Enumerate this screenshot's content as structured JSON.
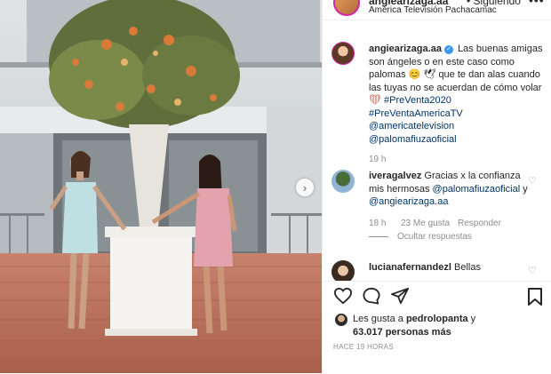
{
  "colors": {
    "accent": "#3897f0",
    "link": "#003569",
    "text": "#262626",
    "muted": "#8e8e8e",
    "heart_emoji": "#c0392b"
  },
  "header": {
    "username": "angiearizaga.aa",
    "follow_label": "• Siguiendo",
    "location": "América Televisión Pachacamac",
    "more_label": "•••"
  },
  "photo": {
    "next_label": "›"
  },
  "caption": {
    "username": "angiearizaga.aa",
    "text_1": "Las buenas amigas son ángeles o en este caso como palomas",
    "emoji_1": "😊",
    "emoji_2": "🕊",
    "text_2": "que te dan alas cuando las tuyas no se acuerdan de cómo volar",
    "emoji_3": "❤",
    "hashtag_1": "#PreVenta2020",
    "hashtag_2": "#PreVentaAmericaTV",
    "mention_1": "@americatelevision",
    "mention_2": "@palomafiuzaoficial",
    "time": "19 h"
  },
  "comment_1": {
    "username": "iveragalvez",
    "text_1": "Gracias x la confianza mis hermosas",
    "mention_1": "@palomafiuzaoficial",
    "conj": "y",
    "mention_2": "@angiearizaga.aa",
    "time": "18 h",
    "likes": "23 Me gusta",
    "reply_label": "Responder",
    "hide_replies_label": "Ocultar respuestas"
  },
  "comment_2": {
    "username": "lucianafernandezl",
    "text": "Bellas"
  },
  "actions": {
    "liked_by_prefix": "Les gusta a",
    "liked_by_user": "pedrolopanta",
    "liked_by_conj": "y",
    "liked_by_count": "63.017 personas más",
    "time_ago": "HACE 19 HORAS"
  }
}
